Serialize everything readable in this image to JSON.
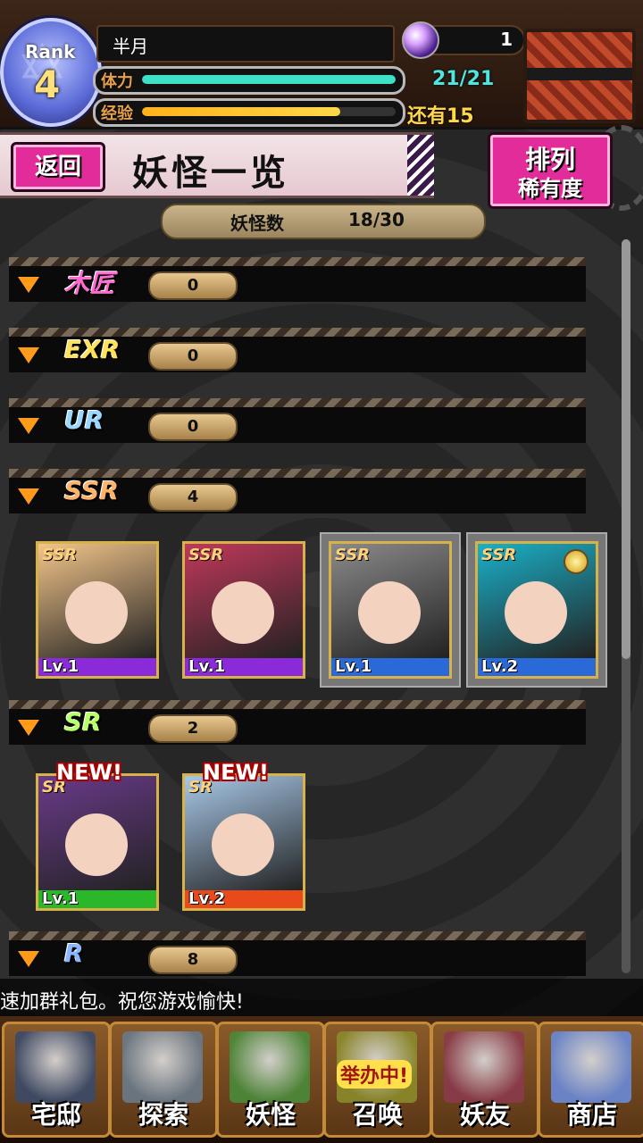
{
  "header": {
    "rank_label": "Rank",
    "rank_value": "4",
    "player_name": "半月",
    "gem_count": "1",
    "stamina_label": "体力",
    "stamina_text": "21/21",
    "stamina_fraction": 1.0,
    "exp_label": "经验",
    "exp_remaining_text": "还有15",
    "exp_fraction": 0.78,
    "chest_icon": "treasure-chest-icon"
  },
  "titlebar": {
    "back_label": "返回",
    "title": "妖怪一览",
    "sort_line1": "排列",
    "sort_line2": "稀有度"
  },
  "count": {
    "label": "妖怪数",
    "value": "18/30"
  },
  "rarity_groups": [
    {
      "label": "木匠",
      "count": "0",
      "color": "#ff6ad0"
    },
    {
      "label": "EXR",
      "count": "0",
      "color": "#ffe25a"
    },
    {
      "label": "UR",
      "count": "0",
      "color": "#9ad8ff"
    },
    {
      "label": "SSR",
      "count": "4",
      "color": "#ffb36a"
    },
    {
      "label": "SR",
      "count": "2",
      "color": "#b8ff6a"
    },
    {
      "label": "R",
      "count": "8",
      "color": "#8ab8ff"
    }
  ],
  "ssr_cards": [
    {
      "rarity": "SSR",
      "level": "Lv.1",
      "bar_color": "#8a2ad8",
      "bg": "#f3c58a"
    },
    {
      "rarity": "SSR",
      "level": "Lv.1",
      "bar_color": "#8a2ad8",
      "bg": "#c0385a"
    },
    {
      "rarity": "SSR",
      "level": "Lv.1",
      "bar_color": "#2a6ad8",
      "bg": "#8a8a8a"
    },
    {
      "rarity": "SSR",
      "level": "Lv.2",
      "bar_color": "#2a6ad8",
      "bg": "#1ab0c8"
    }
  ],
  "sr_cards": [
    {
      "rarity": "SR",
      "level": "Lv.1",
      "new_label": "NEW!",
      "bar_color": "#2ab82a",
      "bg": "#6a3a8a"
    },
    {
      "rarity": "SR",
      "level": "Lv.2",
      "new_label": "NEW!",
      "bar_color": "#e84a1a",
      "bg": "#a8c8e8"
    }
  ],
  "ticker": {
    "text": "速加群礼包。祝您游戏愉快!"
  },
  "nav": {
    "items": [
      {
        "label": "宅邸",
        "icon": "mansion-icon",
        "color": "#3a4a6a"
      },
      {
        "label": "探索",
        "icon": "magnifier-map-icon",
        "color": "#6a7a8a"
      },
      {
        "label": "妖怪",
        "icon": "scroll-icon",
        "color": "#4a8a3a"
      },
      {
        "label": "召唤",
        "icon": "summon-star-icon",
        "badge": "举办中!",
        "color": "#8a8a2a"
      },
      {
        "label": "妖友",
        "icon": "cat-girl-icon",
        "color": "#8a3a4a"
      },
      {
        "label": "商店",
        "icon": "crystal-orb-icon",
        "color": "#6a8ad8"
      }
    ]
  }
}
